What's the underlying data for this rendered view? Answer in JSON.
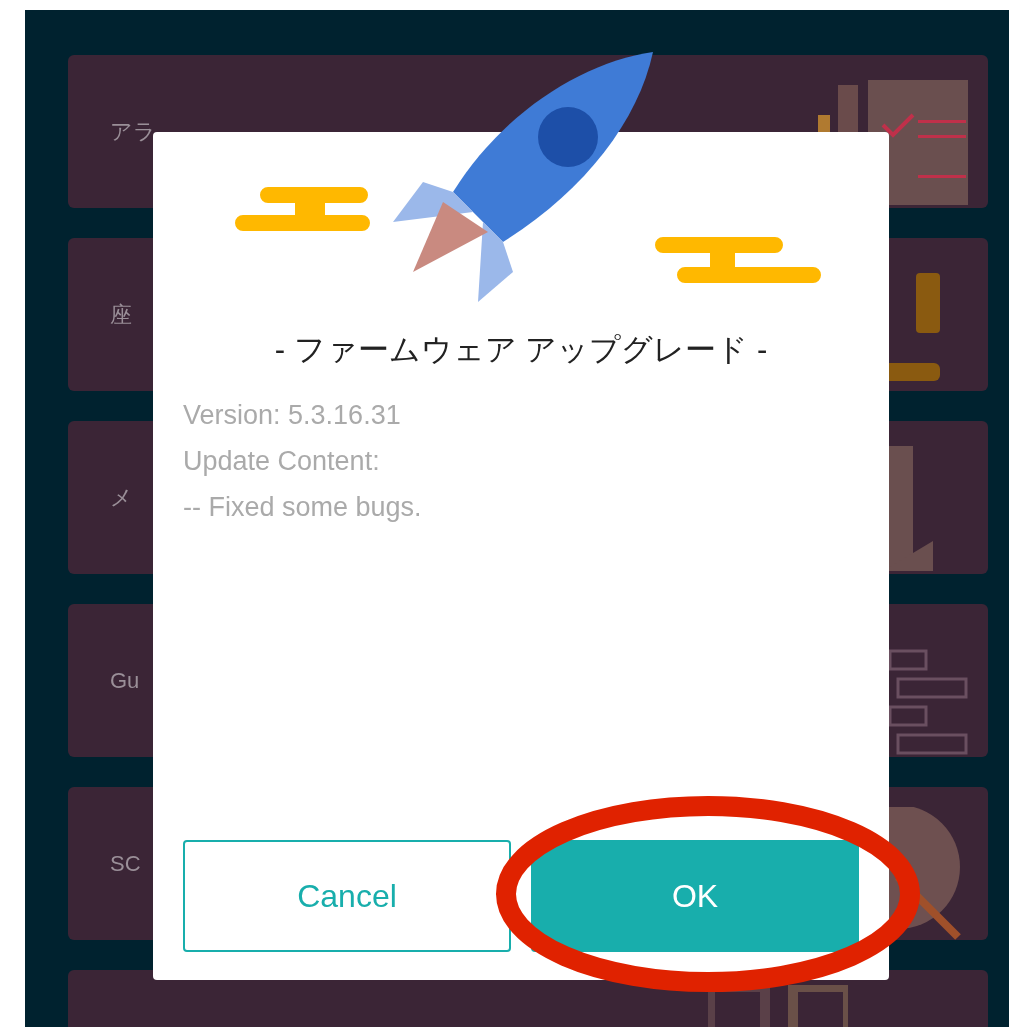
{
  "cards": [
    {
      "label": "アラ",
      "kind": "checklist"
    },
    {
      "label": "座",
      "kind": "bar"
    },
    {
      "label": "メ",
      "kind": "document"
    },
    {
      "label": "Gu",
      "kind": "bricks"
    },
    {
      "label": "SC",
      "kind": "globe"
    },
    {
      "kind": "squares"
    }
  ],
  "dialog": {
    "title": "- ファームウェア アップグレード -",
    "lines": [
      "Version: 5.3.16.31",
      "Update Content:",
      "-- Fixed some bugs."
    ],
    "buttons": [
      {
        "label": "Cancel",
        "kind": "outline",
        "highlighted": false
      },
      {
        "label": "OK",
        "kind": "filled",
        "highlighted": true
      }
    ]
  }
}
